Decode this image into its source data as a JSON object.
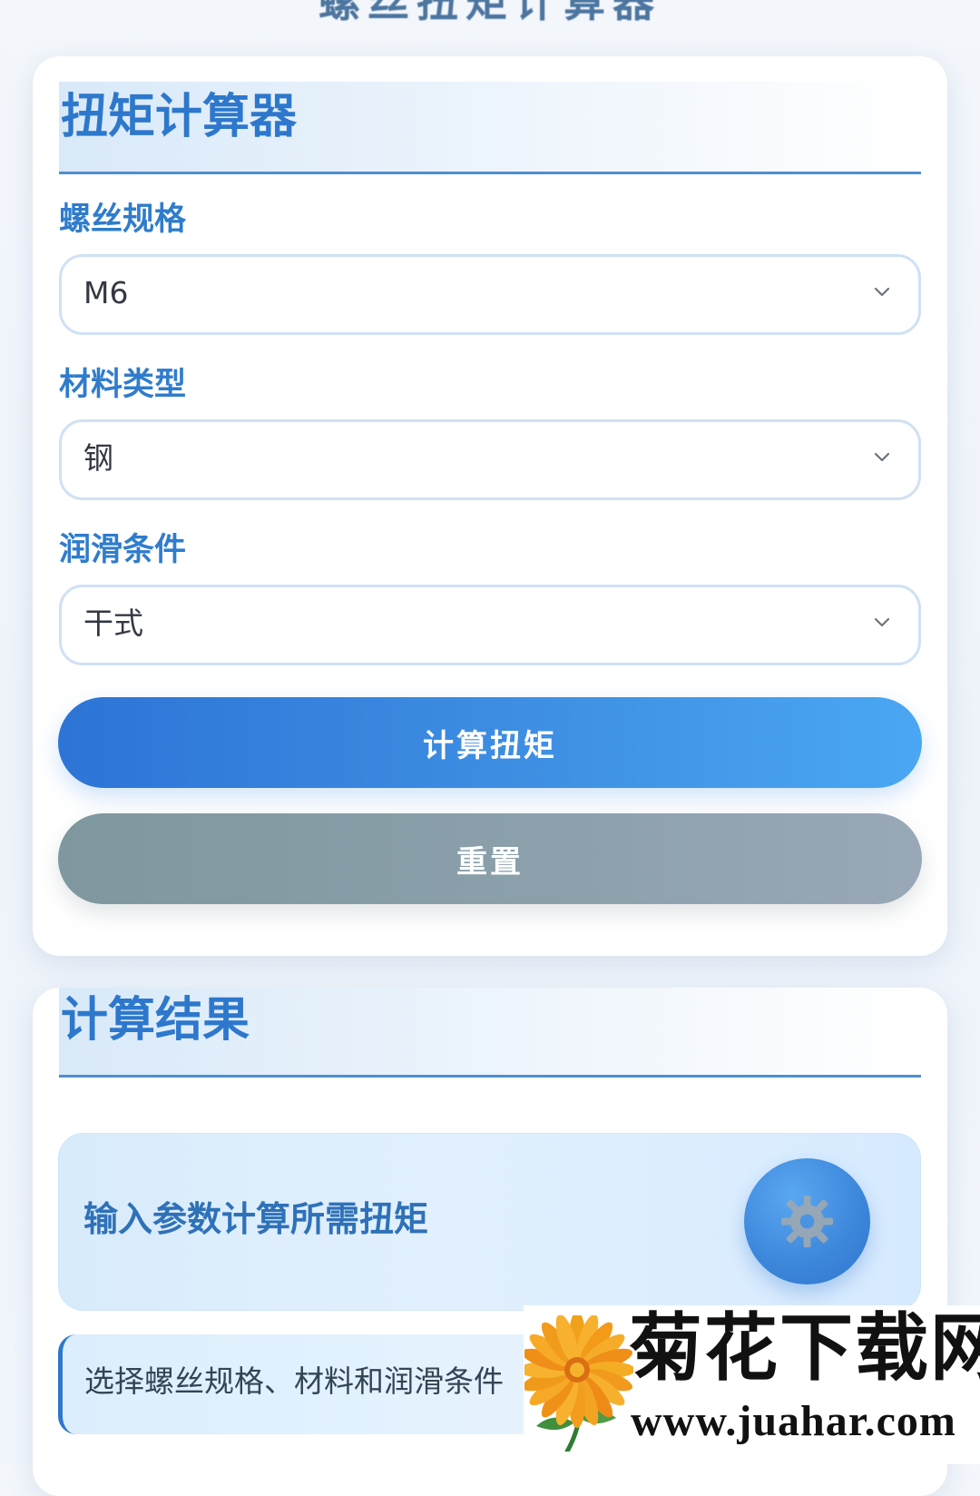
{
  "top_partial_title": "螺丝扭矩计算器",
  "calculator": {
    "title": "扭矩计算器",
    "fields": [
      {
        "label": "螺丝规格",
        "value": "M6"
      },
      {
        "label": "材料类型",
        "value": "钢"
      },
      {
        "label": "润滑条件",
        "value": "干式"
      }
    ],
    "buttons": {
      "calculate": "计算扭矩",
      "reset": "重置"
    }
  },
  "results": {
    "title": "计算结果",
    "prompt": "输入参数计算所需扭矩",
    "hint": "选择螺丝规格、材料和润滑条件"
  },
  "watermark": {
    "site_name": "菊花下载网",
    "url": "www.juahar.com"
  },
  "icons": {
    "dropdown": "chevron-down-icon",
    "result": "gear-icon",
    "watermark_logo": "flower-icon"
  },
  "colors": {
    "accent": "#2d78cc",
    "primary_button": "#3e8fe3",
    "secondary_button": "#8ba0ab",
    "result_background": "#dfeffd"
  }
}
